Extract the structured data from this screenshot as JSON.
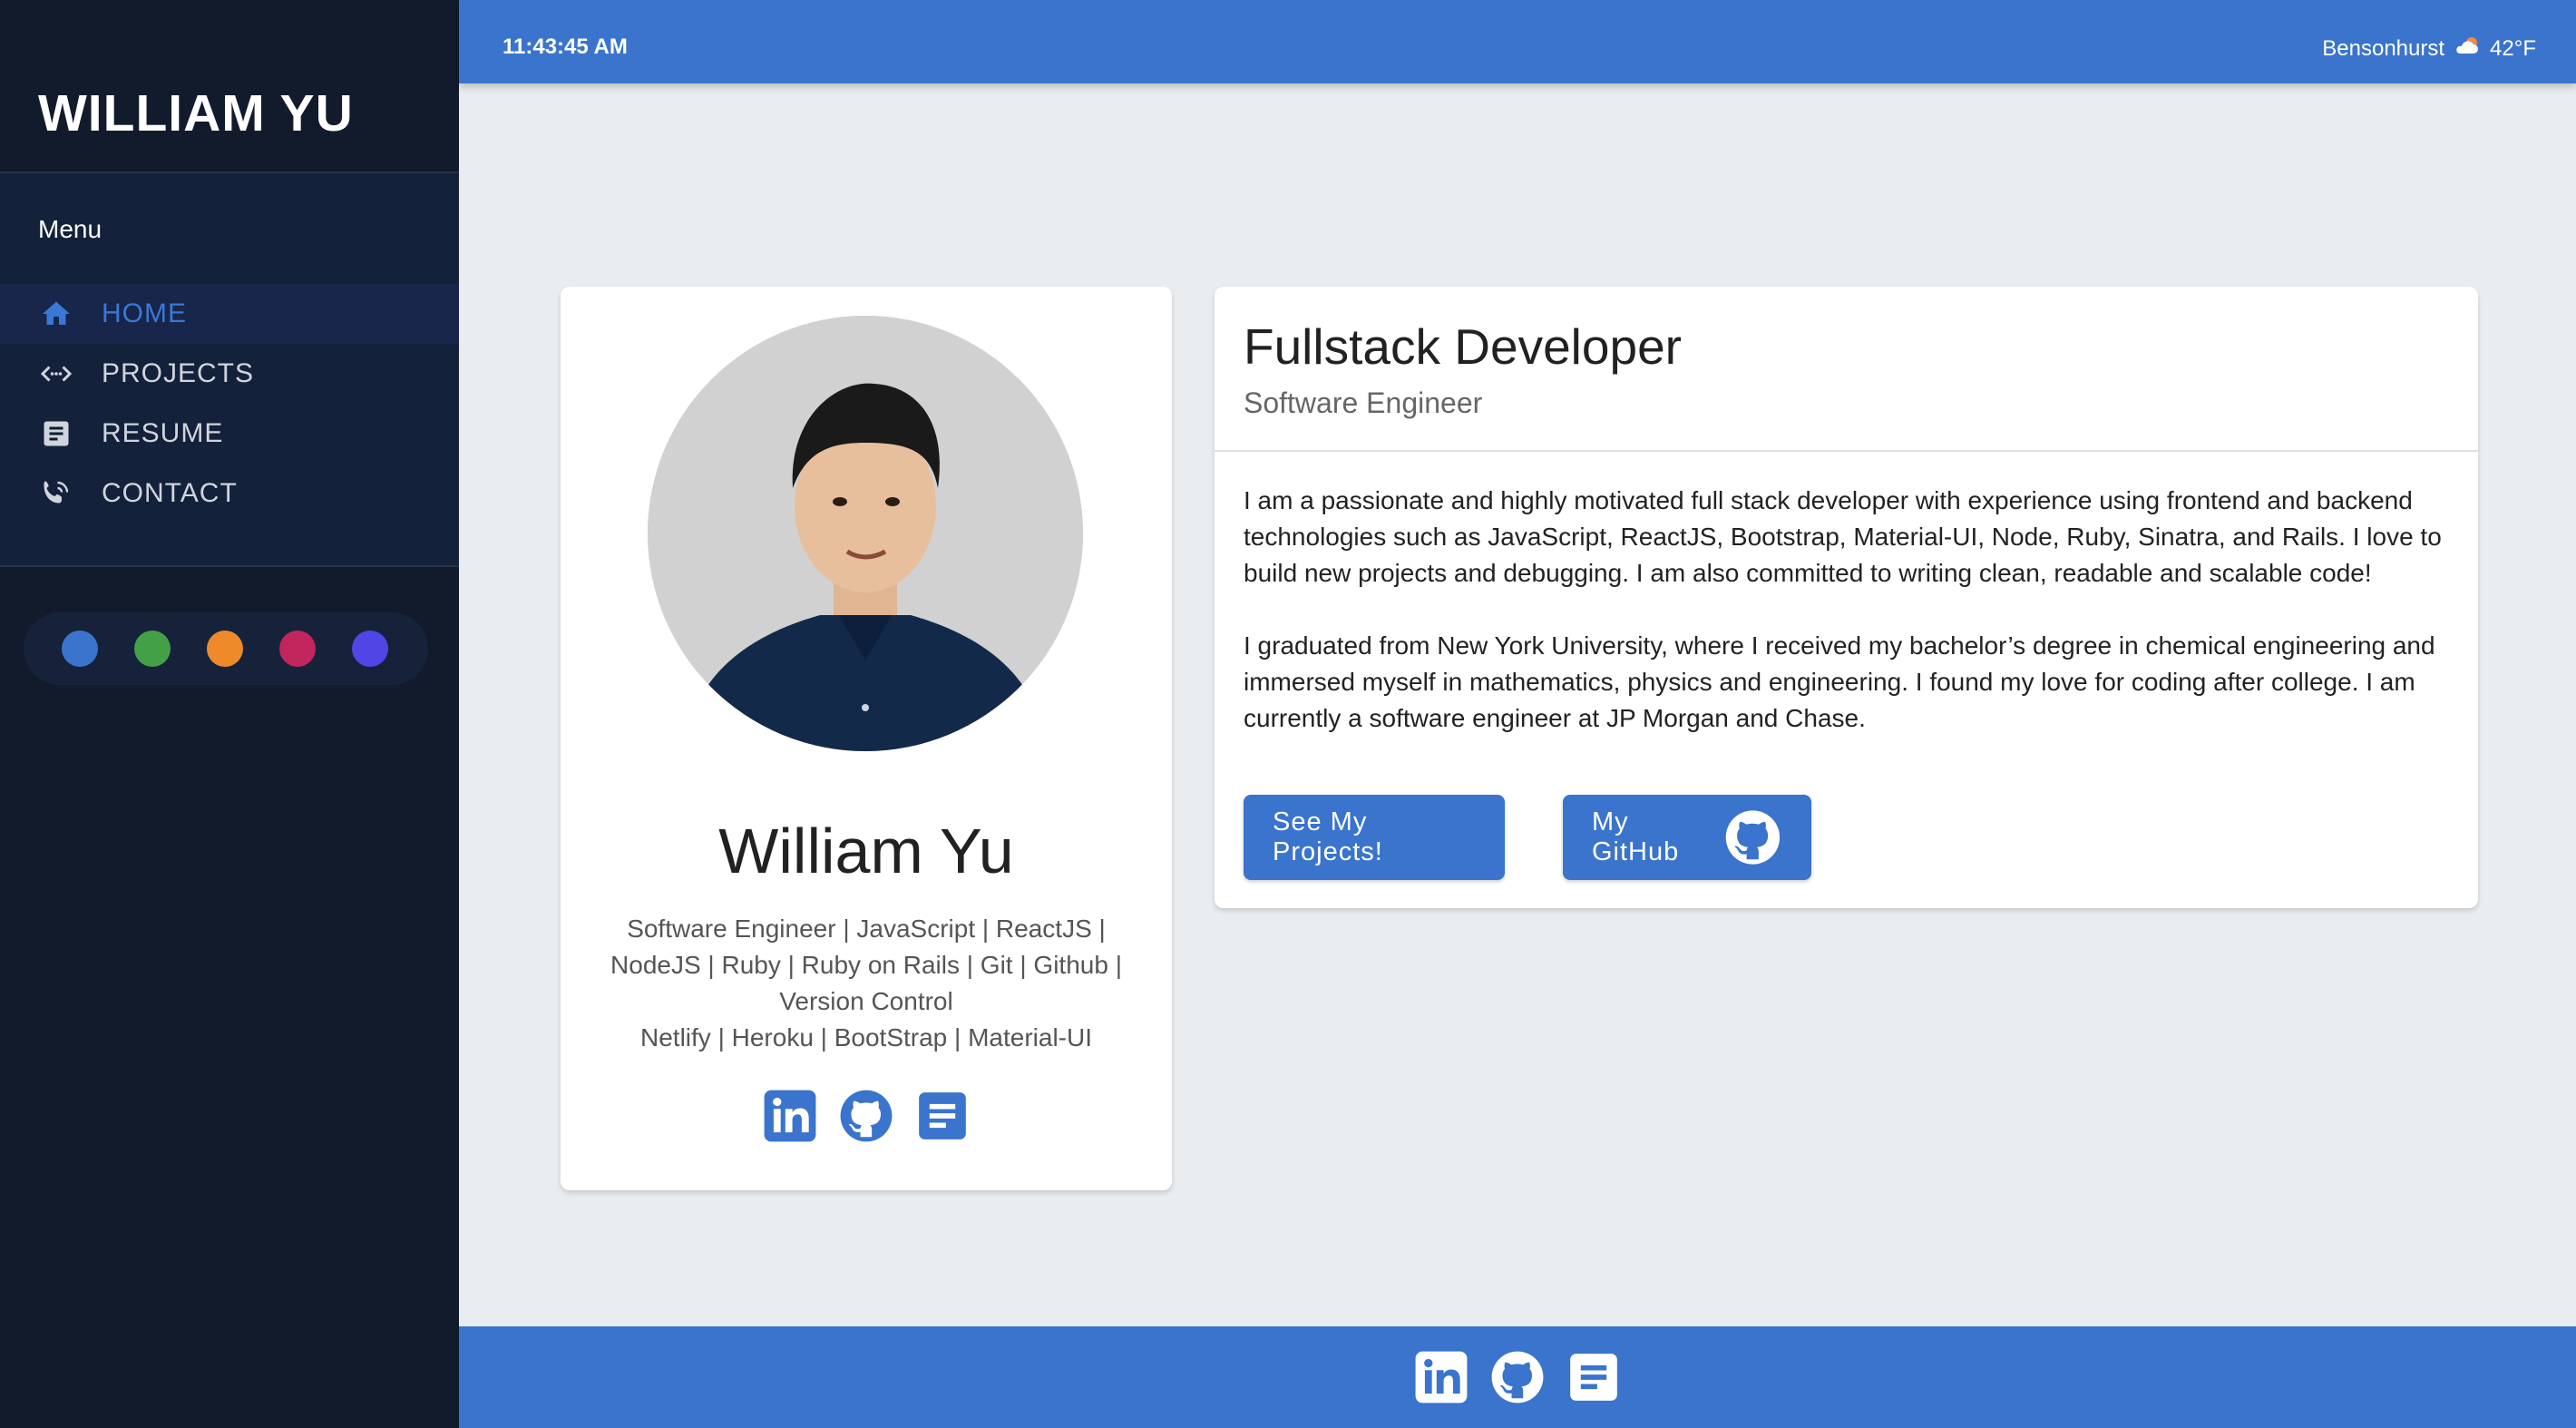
{
  "sidebar": {
    "brand": "WILLIAM YU",
    "menu_title": "Menu",
    "items": [
      {
        "label": "HOME",
        "icon": "home-icon",
        "active": true
      },
      {
        "label": "PROJECTS",
        "icon": "code-icon",
        "active": false
      },
      {
        "label": "RESUME",
        "icon": "document-icon",
        "active": false
      },
      {
        "label": "CONTACT",
        "icon": "contact-icon",
        "active": false
      }
    ],
    "theme_colors": [
      "#3a74cc",
      "#43a047",
      "#ef8a2a",
      "#c2255c",
      "#4f46e5"
    ]
  },
  "header": {
    "time": "11:43:45 AM",
    "location": "Bensonhurst",
    "weather_icon": "cloud-sun-icon",
    "temperature": "42°F"
  },
  "profile": {
    "name": "William Yu",
    "skills_lines": [
      "Software Engineer | JavaScript | ReactJS |",
      "NodeJS | Ruby | Ruby on Rails | Git | Github |",
      "Version Control",
      "Netlify | Heroku | BootStrap | Material-UI"
    ],
    "social_icons": [
      "linkedin-icon",
      "github-icon",
      "resume-icon"
    ]
  },
  "about": {
    "title": "Fullstack Developer",
    "subtitle": "Software Engineer",
    "paragraph1": "I am a passionate and highly motivated full stack developer with experience using frontend and backend technologies such as JavaScript, ReactJS, Bootstrap, Material-UI, Node, Ruby, Sinatra, and Rails. I love to build new projects and debugging. I am also committed to writing clean, readable and scalable code!",
    "paragraph2": "I graduated from New York University, where I received my bachelor’s degree in chemical engineering and immersed myself in mathematics, physics and engineering. I found my love for coding after college. I am currently a software engineer at JP Morgan and Chase.",
    "projects_button": "See My Projects!",
    "github_button": "My GitHub"
  },
  "footer": {
    "icons": [
      "linkedin-icon",
      "github-icon",
      "resume-icon"
    ]
  },
  "colors": {
    "accent": "#3a74cc",
    "sidebar_bg": "#111b2c",
    "page_bg": "#e9edf0"
  }
}
